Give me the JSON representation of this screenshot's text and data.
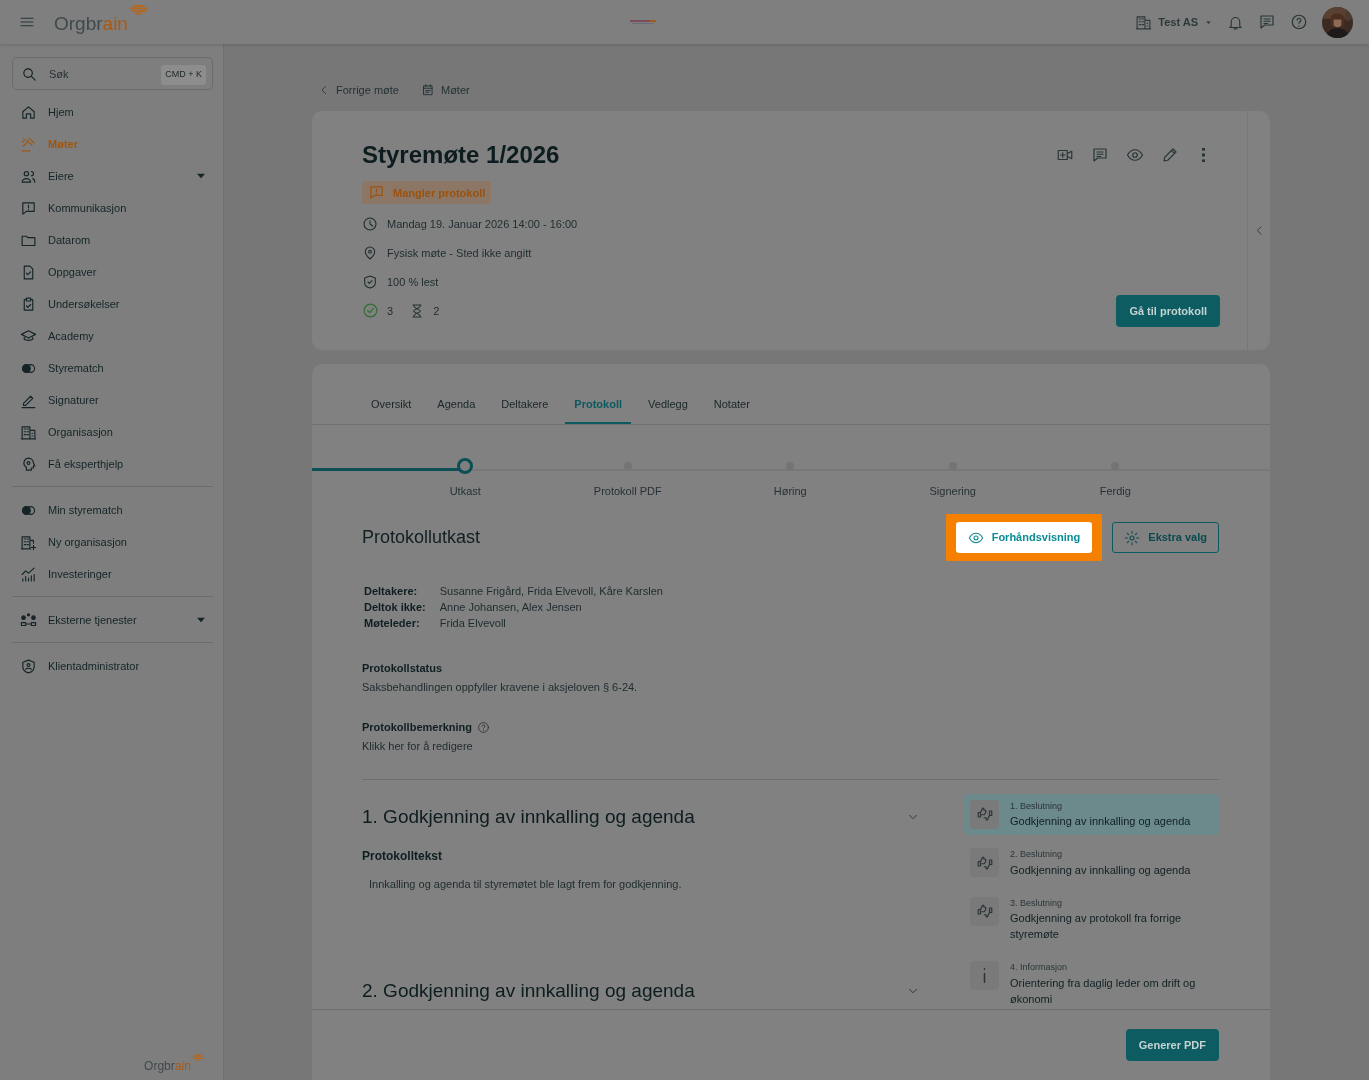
{
  "top_bar": {
    "logo": {
      "main": "Orgbr",
      "accent": "ain"
    },
    "organization": "Test AS"
  },
  "sidebar": {
    "search": {
      "placeholder": "Søk",
      "shortcut": "CMD + K"
    },
    "groups": [
      [
        {
          "label": "Hjem",
          "selected": false,
          "expandable": false
        },
        {
          "label": "Møter",
          "selected": true,
          "expandable": false
        },
        {
          "label": "Eiere",
          "selected": false,
          "expandable": true
        },
        {
          "label": "Kommunikasjon",
          "selected": false,
          "expandable": false
        },
        {
          "label": "Datarom",
          "selected": false,
          "expandable": false
        },
        {
          "label": "Oppgaver",
          "selected": false,
          "expandable": false
        },
        {
          "label": "Undersøkelser",
          "selected": false,
          "expandable": false
        },
        {
          "label": "Academy",
          "selected": false,
          "expandable": false
        },
        {
          "label": "Styrematch",
          "selected": false,
          "expandable": false
        },
        {
          "label": "Signaturer",
          "selected": false,
          "expandable": false
        },
        {
          "label": "Organisasjon",
          "selected": false,
          "expandable": false
        },
        {
          "label": "Få eksperthjelp",
          "selected": false,
          "expandable": false
        }
      ],
      [
        {
          "label": "Min styrematch",
          "selected": false,
          "expandable": false
        },
        {
          "label": "Ny organisasjon",
          "selected": false,
          "expandable": false
        },
        {
          "label": "Investeringer",
          "selected": false,
          "expandable": false
        }
      ],
      [
        {
          "label": "Eksterne tjenester",
          "selected": false,
          "expandable": true
        }
      ],
      [
        {
          "label": "Klientadministrator",
          "selected": false,
          "expandable": false
        }
      ]
    ],
    "footer_logo": {
      "main": "Orgbr",
      "accent": "ain"
    }
  },
  "breadcrumb": [
    {
      "label": "Forrige møte",
      "kind": "back"
    },
    {
      "label": "Møter",
      "kind": "calendar"
    }
  ],
  "meeting": {
    "title": "Styremøte 1/2026",
    "status": "Mangler protokoll",
    "details": [
      {
        "kind": "time",
        "text": "Mandag 19. Januar 2026 14:00 - 16:00"
      },
      {
        "kind": "location",
        "text": "Fysisk møte - Sted ikke angitt"
      },
      {
        "kind": "read",
        "text": "100 % lest"
      }
    ],
    "counts": [
      {
        "kind": "done",
        "text": "3"
      },
      {
        "kind": "pending",
        "text": "2"
      }
    ],
    "button": "Gå til protokoll"
  },
  "tabs": [
    {
      "label": "Oversikt",
      "selected": false
    },
    {
      "label": "Agenda",
      "selected": false
    },
    {
      "label": "Deltakere",
      "selected": false
    },
    {
      "label": "Protokoll",
      "selected": true
    },
    {
      "label": "Vedlegg",
      "selected": false
    },
    {
      "label": "Notater",
      "selected": false
    }
  ],
  "stepper": [
    {
      "label": "Utkast",
      "selected": true
    },
    {
      "label": "Protokoll PDF",
      "selected": false
    },
    {
      "label": "Høring",
      "selected": false
    },
    {
      "label": "Signering",
      "selected": false
    },
    {
      "label": "Ferdig",
      "selected": false
    }
  ],
  "draft": {
    "title": "Protokollutkast",
    "buttons": [
      {
        "label": "Forhåndsvisning",
        "kind": "preview",
        "highlighted": true
      },
      {
        "label": "Ekstra valg",
        "kind": "options",
        "highlighted": false
      }
    ],
    "participants": [
      {
        "label": "Deltakere:",
        "value": "Susanne Frigård, Frida Elvevoll, Kåre Karslen"
      },
      {
        "label": "Deltok ikke:",
        "value": "Anne Johansen, Alex Jensen"
      },
      {
        "label": "Møteleder:",
        "value": "Frida Elvevoll"
      }
    ],
    "status": {
      "title": "Protokollstatus",
      "text": "Saksbehandlingen oppfyller kravene i aksjeloven § 6-24."
    },
    "remark": {
      "title": "Protokollbemerkning",
      "text": "Klikk her for å redigere"
    }
  },
  "agenda_items": [
    {
      "title": "1. Godkjenning av innkalling og agenda",
      "subtitle": "Protokolltekst",
      "text": "Innkalling og agenda til styremøtet ble lagt frem for godkjenning."
    },
    {
      "title": "2. Godkjenning av innkalling og agenda"
    }
  ],
  "agenda_nav": [
    {
      "kind": "decision",
      "label": "1. Beslutning",
      "title": "Godkjenning av innkalling og agenda",
      "selected": true
    },
    {
      "kind": "decision",
      "label": "2. Beslutning",
      "title": "Godkjenning av innkalling og agenda",
      "selected": false
    },
    {
      "kind": "decision",
      "label": "3. Beslutning",
      "title": "Godkjenning av protokoll fra forrige styremøte",
      "selected": false
    },
    {
      "kind": "info",
      "label": "4. Informasjon",
      "title": "Orientering fra daglig leder om drift og økonomi",
      "selected": false
    }
  ],
  "footer_button": "Generer PDF"
}
